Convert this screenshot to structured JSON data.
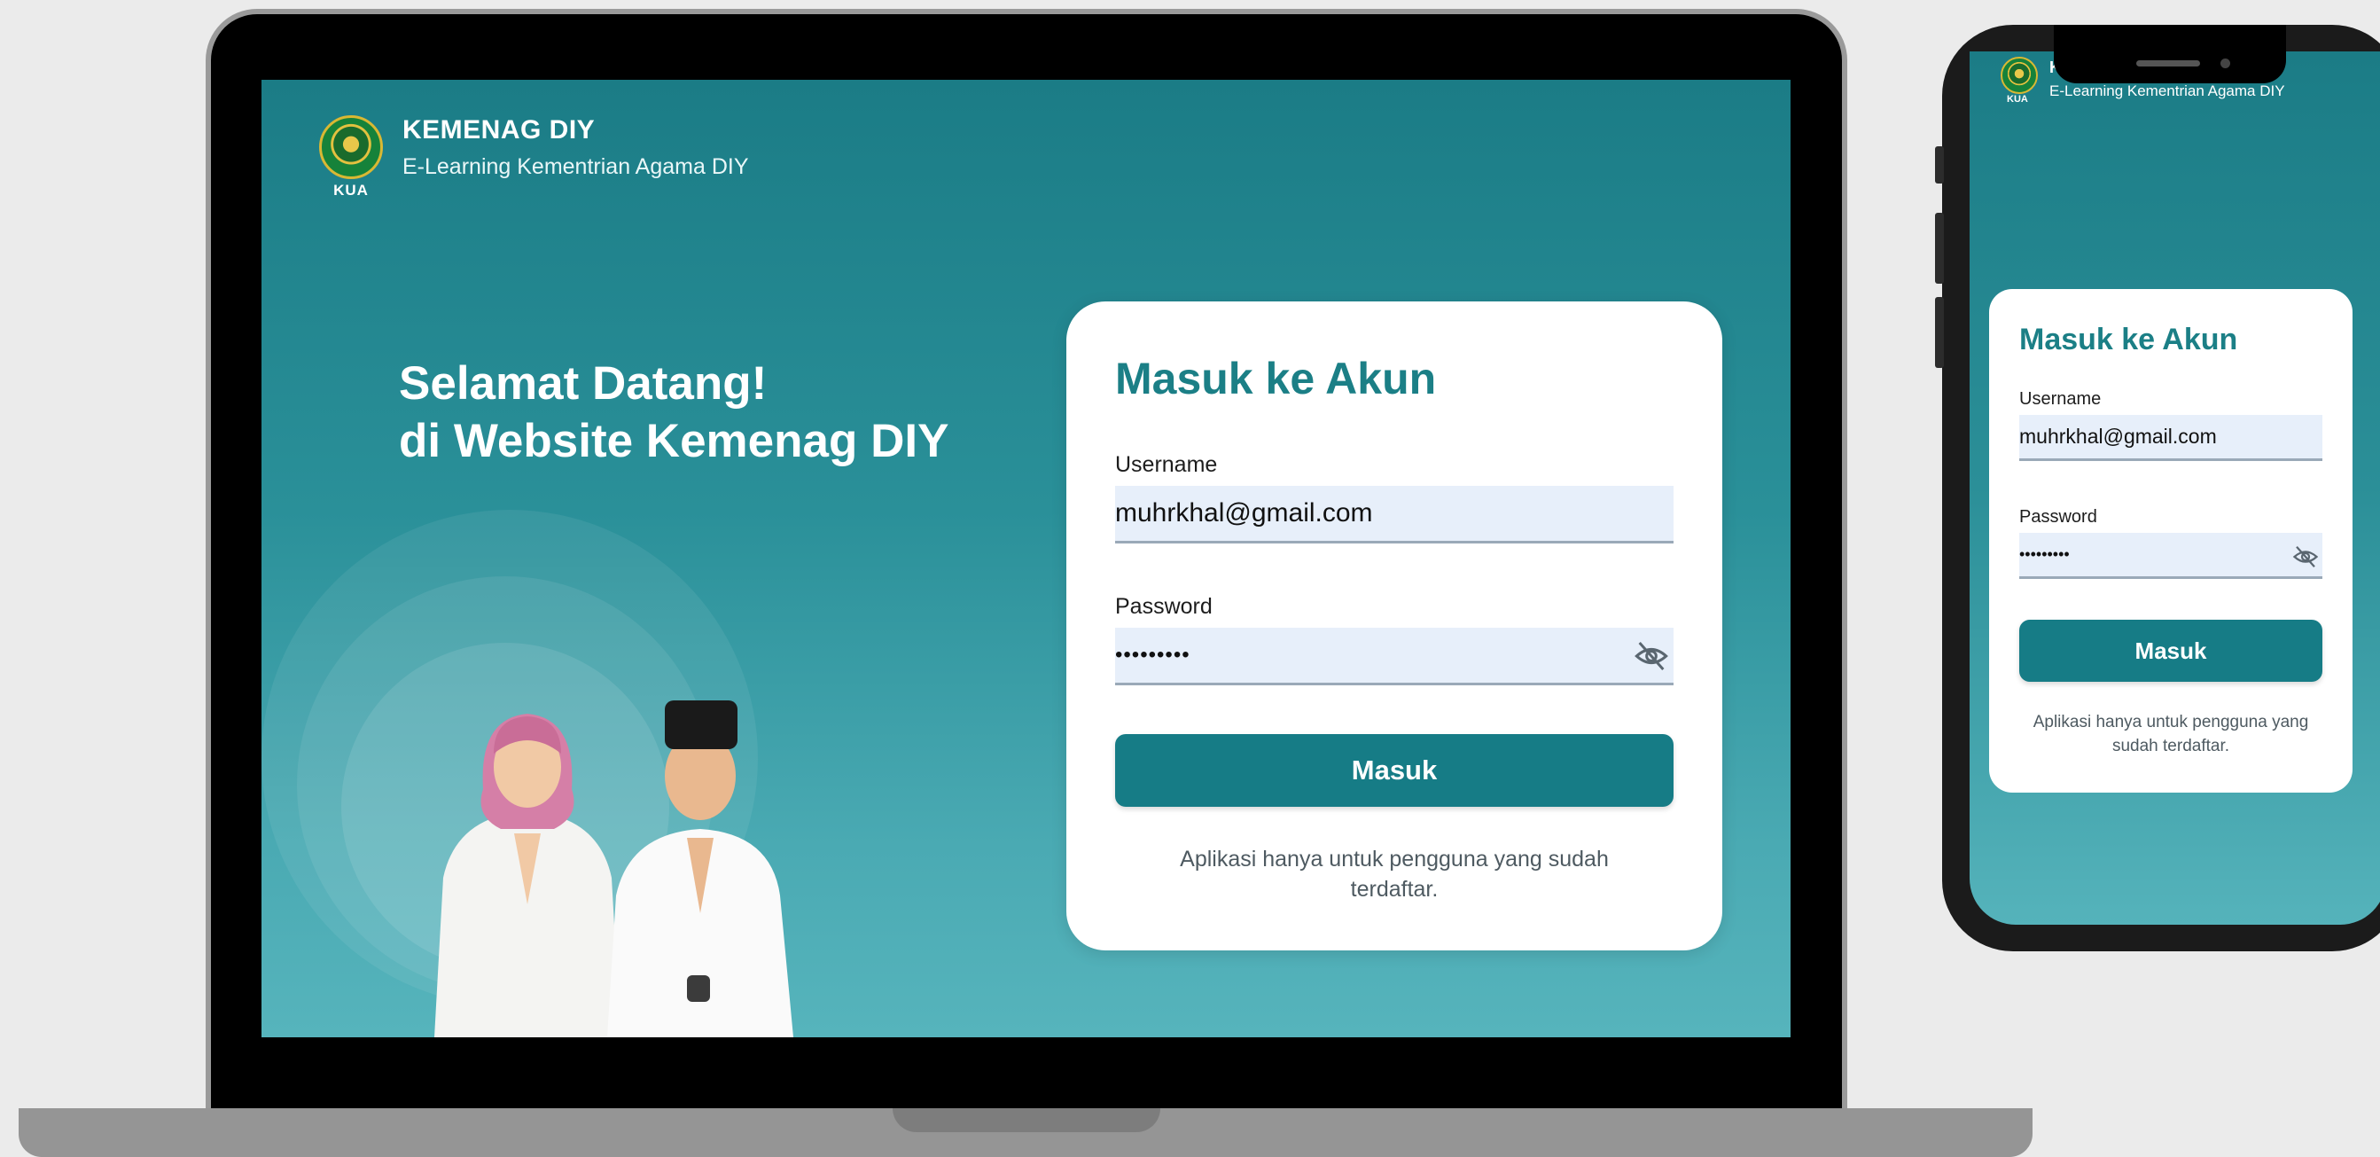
{
  "brand": {
    "title": "KEMENAG DIY",
    "subtitle": "E-Learning Kementrian Agama DIY",
    "logo_caption": "KUA",
    "mobile_title_partial": "K"
  },
  "hero": {
    "line1": "Selamat Datang!",
    "line2": "di Website Kemenag DIY"
  },
  "login": {
    "title": "Masuk ke Akun",
    "username_label": "Username",
    "username_value": "muhrkhal@gmail.com",
    "password_label": "Password",
    "password_value": "•••••••••",
    "submit_label": "Masuk",
    "note": "Aplikasi hanya untuk pengguna yang sudah terdaftar."
  },
  "icons": {
    "password_toggle": "eye-off-icon"
  },
  "colors": {
    "primary": "#167c86",
    "title": "#1b7f86",
    "field_bg": "#e7effa",
    "screen_bg": "#2a9099"
  }
}
